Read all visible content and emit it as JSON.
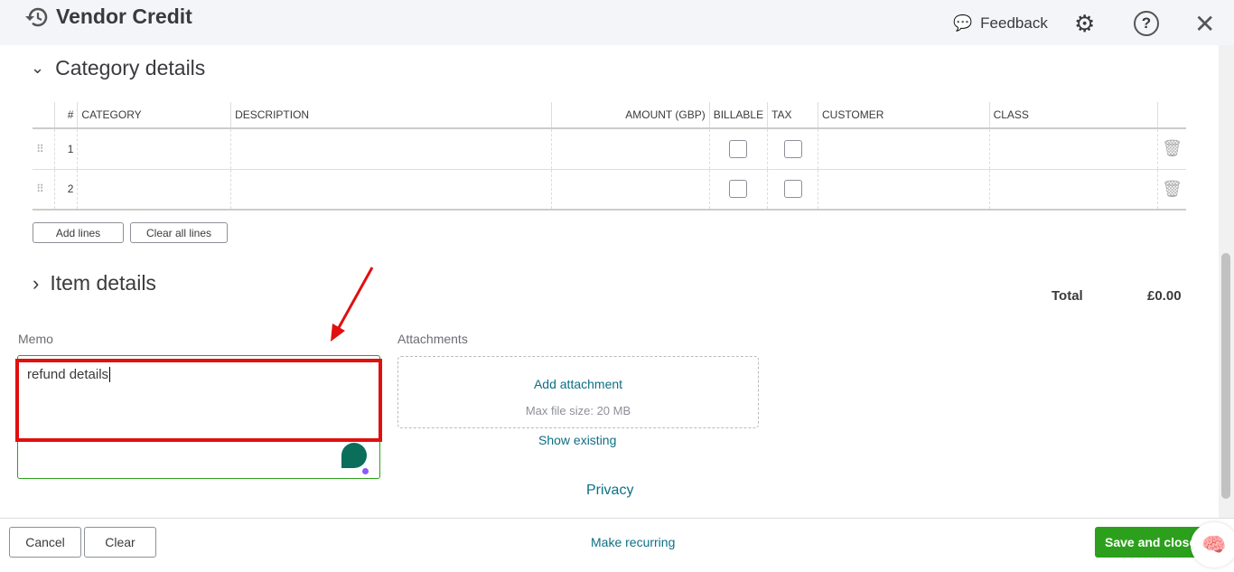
{
  "header": {
    "title": "Vendor Credit",
    "feedback": "Feedback"
  },
  "category": {
    "title": "Category details",
    "columns": [
      "#",
      "CATEGORY",
      "DESCRIPTION",
      "AMOUNT (GBP)",
      "BILLABLE",
      "TAX",
      "CUSTOMER",
      "CLASS"
    ],
    "rows": [
      "1",
      "2"
    ],
    "add_lines": "Add lines",
    "clear_lines": "Clear all lines"
  },
  "item": {
    "title": "Item details"
  },
  "total": {
    "label": "Total",
    "value": "£0.00"
  },
  "memo": {
    "label": "Memo",
    "value": "refund details"
  },
  "attachments": {
    "label": "Attachments",
    "add": "Add attachment",
    "max": "Max file size: 20 MB",
    "show": "Show existing"
  },
  "privacy": "Privacy",
  "footer": {
    "cancel": "Cancel",
    "clear": "Clear",
    "recurring": "Make recurring",
    "save": "Save and close"
  },
  "colors": {
    "accent": "#2ca01c",
    "link": "#0d6f85",
    "annotation": "#e01010"
  }
}
